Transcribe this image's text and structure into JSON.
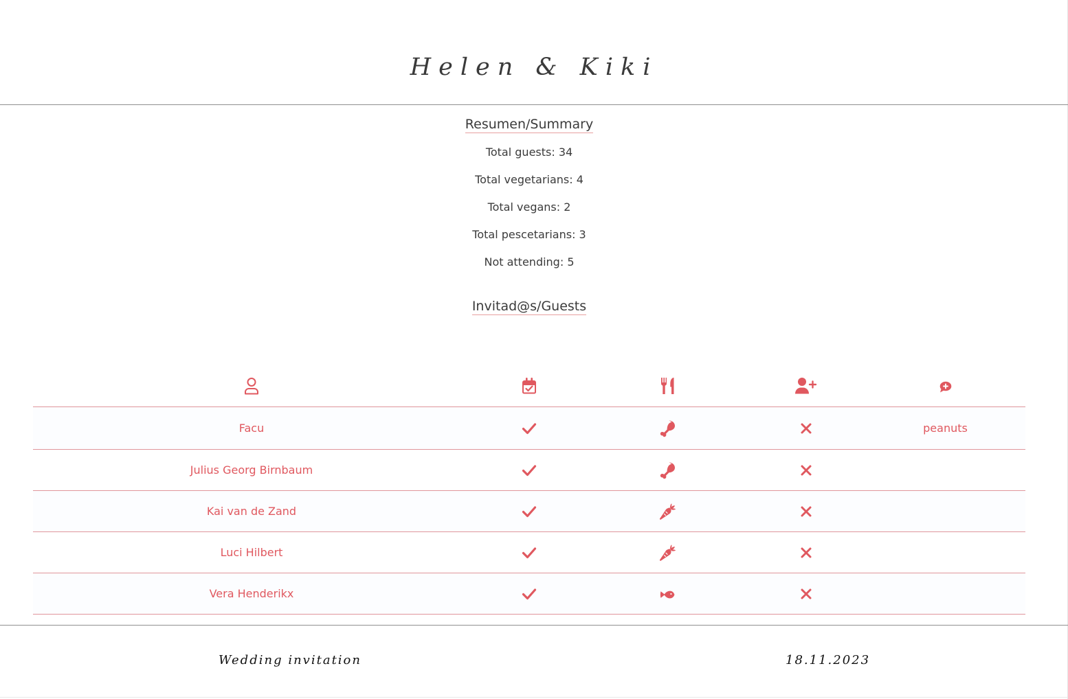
{
  "header": {
    "title": "Helen & Kiki"
  },
  "summary": {
    "heading": "Resumen/Summary",
    "items": [
      "Total guests: 34",
      "Total vegetarians: 4",
      "Total vegans: 2",
      "Total pescetarians: 3",
      "Not attending: 5"
    ]
  },
  "guests": {
    "heading": "Invitad@s/Guests",
    "columns": [
      {
        "icon": "user-icon"
      },
      {
        "icon": "calendar-check-icon"
      },
      {
        "icon": "utensils-icon"
      },
      {
        "icon": "user-plus-icon"
      },
      {
        "icon": "comment-plus-icon"
      }
    ],
    "rows": [
      {
        "name": "Facu",
        "attending": "check-icon",
        "diet": "drumstick-icon",
        "plus_one": "x-icon",
        "notes": "peanuts"
      },
      {
        "name": "Julius Georg Birnbaum",
        "attending": "check-icon",
        "diet": "drumstick-icon",
        "plus_one": "x-icon",
        "notes": ""
      },
      {
        "name": "Kai van de Zand",
        "attending": "check-icon",
        "diet": "carrot-icon",
        "plus_one": "x-icon",
        "notes": ""
      },
      {
        "name": "Luci Hilbert",
        "attending": "check-icon",
        "diet": "carrot-icon",
        "plus_one": "x-icon",
        "notes": ""
      },
      {
        "name": "Vera Henderikx",
        "attending": "check-icon",
        "diet": "fish-icon",
        "plus_one": "x-icon",
        "notes": ""
      }
    ]
  },
  "footer": {
    "left_text": "Wedding invitation",
    "right_text": "18.11.2023"
  },
  "colors": {
    "accent": "#e0585f",
    "divider": "#e0959b",
    "text": "#3b3b3b"
  }
}
